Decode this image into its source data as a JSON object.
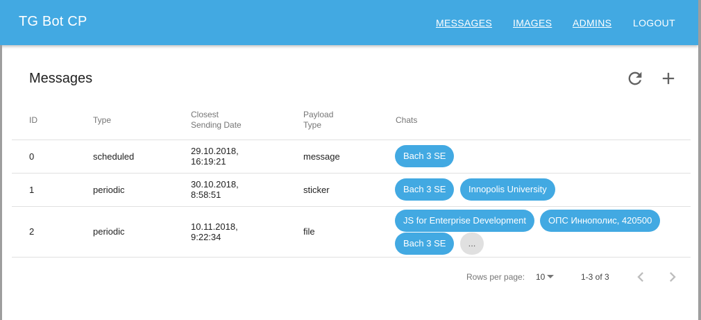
{
  "app": {
    "brand": "TG Bot CP",
    "nav": [
      {
        "label": "MESSAGES"
      },
      {
        "label": "IMAGES"
      },
      {
        "label": "ADMINS"
      },
      {
        "label": "LOGOUT"
      }
    ]
  },
  "main": {
    "title": "Messages",
    "actions": {
      "refresh_icon": "refresh-icon",
      "add_icon": "plus-icon"
    },
    "columns": {
      "id": "ID",
      "type": "Type",
      "date_line1": "Closest",
      "date_line2": "Sending Date",
      "payload_line1": "Payload",
      "payload_line2": "Type",
      "chats": "Chats"
    },
    "rows": [
      {
        "id": "0",
        "type": "scheduled",
        "date_line1": "29.10.2018,",
        "date_line2": "16:19:21",
        "payload": "message",
        "chats": [
          "Bach 3 SE"
        ]
      },
      {
        "id": "1",
        "type": "periodic",
        "date_line1": "30.10.2018,",
        "date_line2": "8:58:51",
        "payload": "sticker",
        "chats": [
          "Bach 3 SE",
          "Innopolis University"
        ]
      },
      {
        "id": "2",
        "type": "periodic",
        "date_line1": "10.11.2018,",
        "date_line2": "9:22:34",
        "payload": "file",
        "chats": [
          "JS for Enterprise Development",
          "ОПС Иннополис, 420500",
          "Bach 3 SE"
        ],
        "more": "..."
      }
    ]
  },
  "pagination": {
    "rows_per_page_label": "Rows per page:",
    "rows_per_page_value": "10",
    "range": "1-3 of 3"
  },
  "colors": {
    "accent": "#42a9e2",
    "chip_more": "#e0e0e0"
  }
}
